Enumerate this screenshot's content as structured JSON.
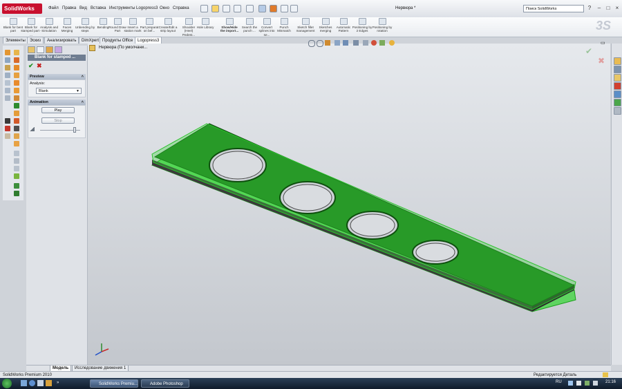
{
  "app": {
    "logo": "SolidWorks",
    "doc_title": "Нервюра *"
  },
  "menu": [
    "Файл",
    "Правка",
    "Вид",
    "Вставка",
    "Инструменты",
    "Logopress3",
    "Окно",
    "Справка"
  ],
  "search": {
    "placeholder": "Поиск SolidWorks"
  },
  "ribbon": [
    "Blank for bent part",
    "Blank for stamped part - ...",
    "Analysis and Simulation",
    "Faces Merging",
    "Unbending by steps",
    "Bending",
    "Round Draw Part",
    "Insert a station mark",
    "Part preparat on bef...",
    "Create/Edit a strip layout",
    "Shoulder (Heel) Pedest...",
    "Hole Library",
    "Show/Hide the import...",
    "Search the punch ...",
    "Convert splines into se...",
    "Punch Mismatch",
    "Sketch fillet management",
    "Sketches merging",
    "Automatic Pattern",
    "Positioning by 2 Edges",
    "Positioning by rotation"
  ],
  "command_tabs": [
    "Элементы",
    "Эскиз",
    "Анализировать",
    "DimXpert",
    "Продукты Office",
    "Logopress3"
  ],
  "property_manager": {
    "title": "Blank for stamped ...",
    "preview_label": "Preview",
    "analysis_label": "Analysis:",
    "analysis_value": "Blank",
    "animation_label": "Animation",
    "play_label": "Play",
    "stop_label": "Stop"
  },
  "feature_tree": {
    "path": "Нервюра  (По умолчани..."
  },
  "bottom_tabs": [
    "Модель",
    "Исследование движения 1"
  ],
  "status": {
    "left": "SolidWorks Premium 2010",
    "right": "Редактируется Деталь"
  },
  "taskbar": {
    "tasks": [
      "SolidWorks Premiu...",
      "Adobe Photoshop"
    ],
    "lang": "RU",
    "clock": "21:16"
  },
  "colors": {
    "part_green": "#1f7a1f",
    "highlight_green": "#39d63a",
    "title_red": "#c8102e",
    "viewport_top": "#e6e9ed",
    "viewport_bottom": "#c3c7cd"
  }
}
